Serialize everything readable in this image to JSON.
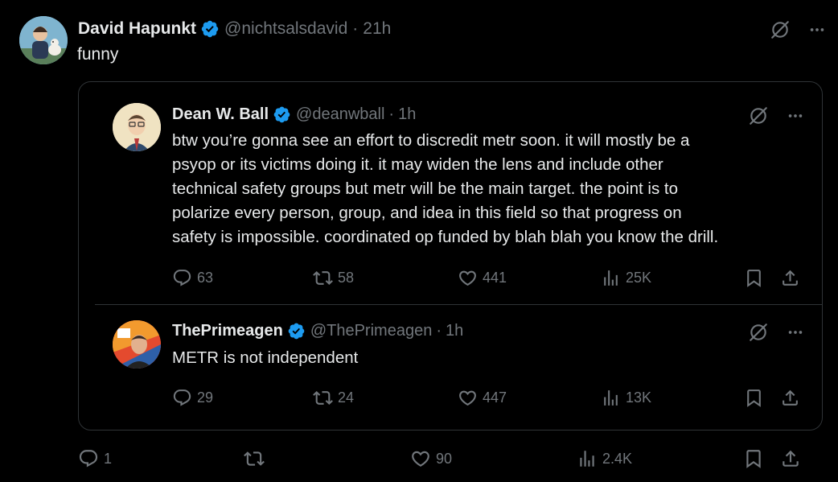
{
  "main_tweet": {
    "author_name": "David Hapunkt",
    "handle": "@nichtsalsdavid",
    "separator": "·",
    "time": "21h",
    "text": "funny",
    "stats": {
      "replies": "1",
      "retweets": "",
      "likes": "90",
      "views": "2.4K"
    }
  },
  "quoted_thread": [
    {
      "author_name": "Dean W. Ball",
      "handle": "@deanwball",
      "separator": "·",
      "time": "1h",
      "text": "btw you’re gonna see an effort to discredit metr soon. it will mostly be a\npsyop or its victims doing it. it may widen the lens and include other\ntechnical safety groups but metr will be the main target. the point is to\npolarize every person, group, and idea in this field so that progress on\nsafety is impossible. coordinated op funded by blah blah you know the drill.",
      "stats": {
        "replies": "63",
        "retweets": "58",
        "likes": "441",
        "views": "25K"
      }
    },
    {
      "author_name": "ThePrimeagen",
      "handle": "@ThePrimeagen",
      "separator": "·",
      "time": "1h",
      "text": "METR is not independent",
      "stats": {
        "replies": "29",
        "retweets": "24",
        "likes": "447",
        "views": "13K"
      }
    }
  ],
  "colors": {
    "background": "#000000",
    "text_primary": "#e7e9ea",
    "text_secondary": "#71767b",
    "verified_badge": "#1d9bf0",
    "border": "#2f3336"
  },
  "icons": [
    "grok-icon",
    "more-icon",
    "reply-icon",
    "retweet-icon",
    "like-icon",
    "views-icon",
    "bookmark-icon",
    "share-icon",
    "verified-badge-icon"
  ]
}
